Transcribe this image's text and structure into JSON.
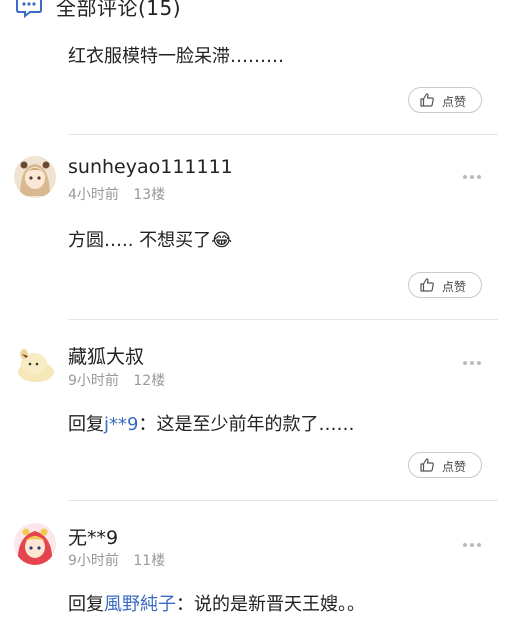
{
  "header": {
    "title": "全部评论(15)",
    "icon": "comment-icon"
  },
  "comments": [
    {
      "text": "红衣服模特一脸呆滞………",
      "like_label": "点赞"
    },
    {
      "username": "sunheyao111111",
      "time": "4小时前",
      "floor": "13楼",
      "text": "方圆….. 不想买了",
      "emoji": "😂",
      "like_label": "点赞",
      "avatar": "anime-girl-avatar"
    },
    {
      "username": "藏狐大叔",
      "time": "9小时前",
      "floor": "12楼",
      "reply_prefix": "回复",
      "reply_to": "j**9",
      "text": "：这是至少前年的款了……",
      "like_label": "点赞",
      "avatar": "yellow-bear-avatar"
    },
    {
      "username": "无**9",
      "time": "9小时前",
      "floor": "11楼",
      "reply_prefix": "回复",
      "reply_to": "風野純子",
      "text": "：说的是新晋天王嫂。。",
      "avatar": "sailor-moon-avatar"
    }
  ],
  "colors": {
    "link": "#3b6cc4",
    "meta": "#999999",
    "divider": "#e6e6e6"
  }
}
